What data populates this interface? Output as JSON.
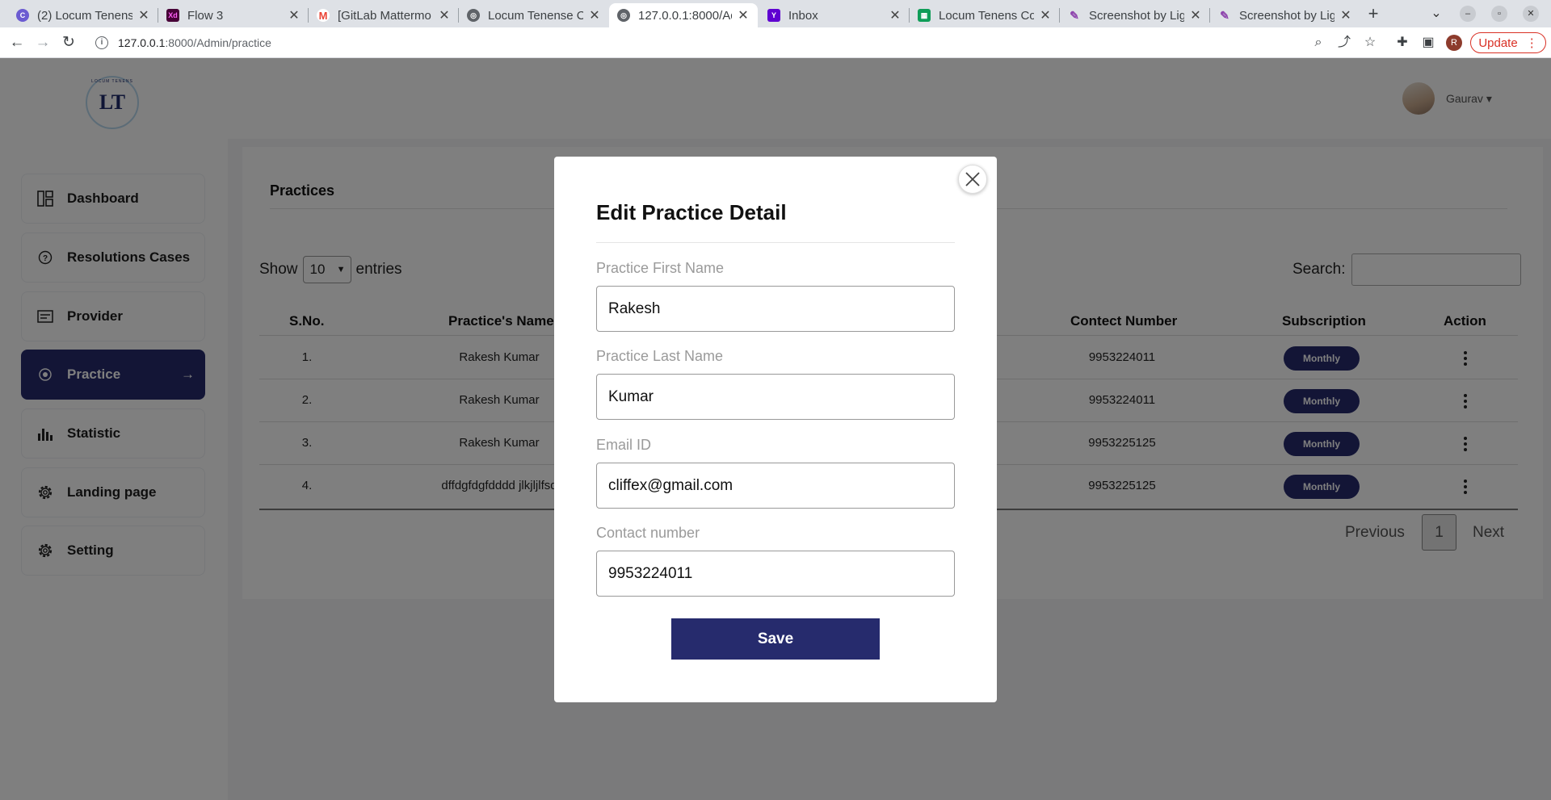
{
  "browser": {
    "tabs": [
      {
        "title": "(2) Locum Tenens",
        "fav_color": "#6b5bd1"
      },
      {
        "title": "Flow 3",
        "fav_color": "#470137"
      },
      {
        "title": "[GitLab Mattermo",
        "fav_color": "#ea4335"
      },
      {
        "title": "Locum Tenense C",
        "fav_color": "#5f6368"
      },
      {
        "title": "127.0.0.1:8000/Ad",
        "fav_color": "#5f6368"
      },
      {
        "title": "Inbox",
        "fav_color": "#5f01d1"
      },
      {
        "title": "Locum Tenens Co",
        "fav_color": "#0f9d58"
      },
      {
        "title": "Screenshot by Lig",
        "fav_color": "#8e44ad"
      },
      {
        "title": "Screenshot by Lig",
        "fav_color": "#8e44ad"
      }
    ],
    "url_host": "127.0.0.1",
    "url_path": ":8000/Admin/practice",
    "update_label": "Update",
    "profile_initial": "R"
  },
  "sidebar": {
    "items": [
      {
        "label": "Dashboard",
        "icon": "dashboard-icon"
      },
      {
        "label": "Resolutions Cases",
        "icon": "question-circle-icon"
      },
      {
        "label": "Provider",
        "icon": "provider-icon"
      },
      {
        "label": "Practice",
        "icon": "practice-icon"
      },
      {
        "label": "Statistic",
        "icon": "bar-chart-icon"
      },
      {
        "label": "Landing page",
        "icon": "gear-icon"
      },
      {
        "label": "Setting",
        "icon": "gear-icon"
      }
    ],
    "active_arrow": "→"
  },
  "header": {
    "username": "Gaurav",
    "caret": "▾"
  },
  "page": {
    "title": "Practices",
    "show_label": "Show",
    "entries_value": "10",
    "entries_label": "entries",
    "search_label": "Search:"
  },
  "table": {
    "headers": [
      "S.No.",
      "Practice's Name",
      "Contect Number",
      "Subscription",
      "Action"
    ],
    "rows": [
      {
        "sno": "1.",
        "name": "Rakesh Kumar",
        "contact": "9953224011",
        "subscription": "Monthly"
      },
      {
        "sno": "2.",
        "name": "Rakesh Kumar",
        "contact": "9953224011",
        "subscription": "Monthly"
      },
      {
        "sno": "3.",
        "name": "Rakesh Kumar",
        "contact": "9953225125",
        "subscription": "Monthly"
      },
      {
        "sno": "4.",
        "name": "dffdgfdgfdddd jlkjljlfsd",
        "contact": "9953225125",
        "subscription": "Monthly"
      }
    ]
  },
  "pagination": {
    "previous": "Previous",
    "current": "1",
    "next": "Next"
  },
  "modal": {
    "title": "Edit Practice Detail",
    "fields": [
      {
        "label": "Practice First Name",
        "value": "Rakesh"
      },
      {
        "label": "Practice Last Name",
        "value": "Kumar"
      },
      {
        "label": "Email ID",
        "value": "cliffex@gmail.com"
      },
      {
        "label": "Contact number",
        "value": "9953224011"
      }
    ],
    "save_label": "Save"
  },
  "colors": {
    "brand": "#262b6d",
    "update": "#d93025"
  }
}
